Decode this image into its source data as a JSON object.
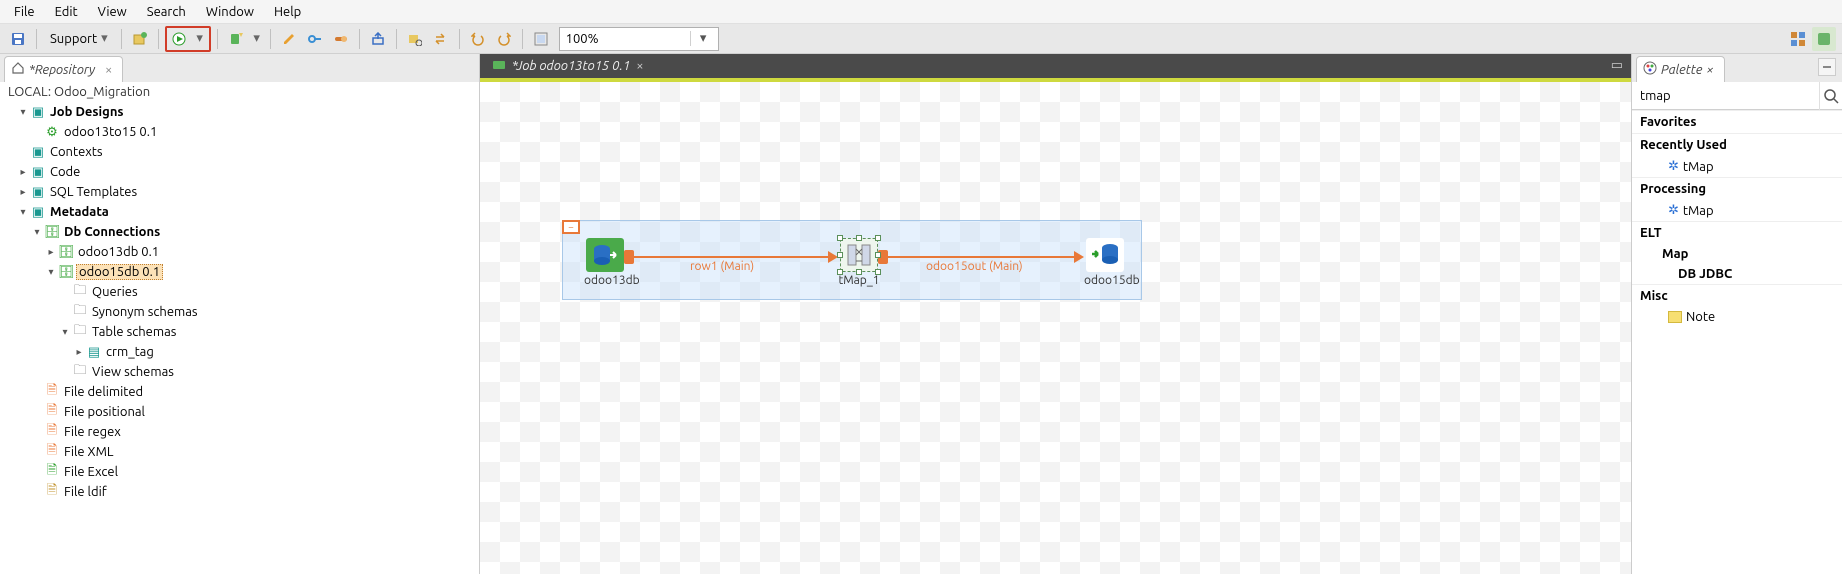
{
  "menubar": {
    "items": [
      "File",
      "Edit",
      "View",
      "Search",
      "Window",
      "Help"
    ]
  },
  "toolbar": {
    "support_label": "Support",
    "zoom_value": "100%"
  },
  "repository": {
    "tab_title": "*Repository",
    "local_label": "LOCAL: Odoo_Migration",
    "tree": {
      "job_designs": "Job Designs",
      "job1": "odoo13to15 0.1",
      "contexts": "Contexts",
      "code": "Code",
      "sql_templates": "SQL Templates",
      "metadata": "Metadata",
      "db_connections": "Db Connections",
      "odoo13db": "odoo13db 0.1",
      "odoo15db": "odoo15db 0.1",
      "queries": "Queries",
      "synonym_schemas": "Synonym schemas",
      "table_schemas": "Table schemas",
      "crm_tag": "crm_tag",
      "view_schemas": "View schemas",
      "file_delimited": "File delimited",
      "file_positional": "File positional",
      "file_regex": "File regex",
      "file_xml": "File XML",
      "file_excel": "File Excel",
      "file_ldif": "File ldif"
    }
  },
  "canvas": {
    "tab_title": "*Job odoo13to15 0.1",
    "components": {
      "src": "odoo13db",
      "map": "tMap_1",
      "tgt": "odoo15db"
    },
    "links": {
      "row1": "row1 (Main)",
      "out": "odoo15out (Main)"
    }
  },
  "palette": {
    "tab_title": "Palette",
    "search_value": "tmap",
    "groups": {
      "favorites": "Favorites",
      "recently_used": "Recently Used",
      "tmap1": "tMap",
      "processing": "Processing",
      "tmap2": "tMap",
      "elt": "ELT",
      "map": "Map",
      "db_jdbc": "DB JDBC",
      "misc": "Misc",
      "note": "Note"
    }
  }
}
